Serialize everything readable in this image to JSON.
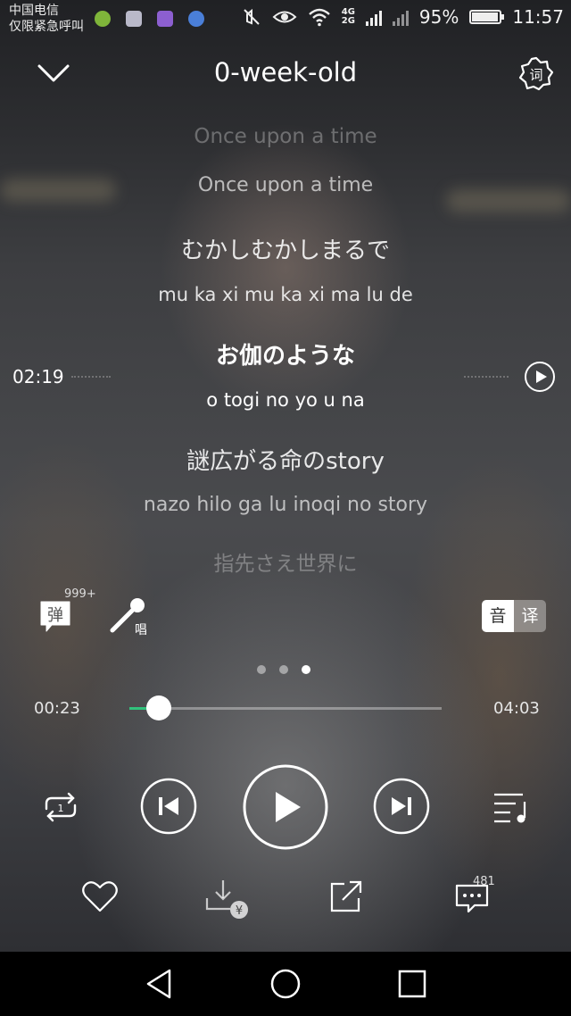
{
  "status_bar": {
    "carrier_line1": "中国电信",
    "carrier_line2": "仅限紧急呼叫",
    "network_top": "4G",
    "network_bottom": "2G",
    "battery": "95%",
    "battery_level": 0.95,
    "time": "11:57"
  },
  "header": {
    "title": "0-week-old",
    "back_icon": "chevron-down-icon",
    "settings_icon": "lyrics-settings-icon",
    "settings_glyph": "词"
  },
  "lyrics": {
    "lines": [
      {
        "text": "Once upon a time",
        "style": "faint"
      },
      {
        "text": "Once upon a time",
        "style": "dim"
      },
      {
        "text": "むかしむかしまるで",
        "style": "jp"
      },
      {
        "text": "mu ka xi mu ka xi ma lu de",
        "style": "rom"
      },
      {
        "text": "お伽のような",
        "style": "current-jp"
      },
      {
        "text": "o togi no yo u na",
        "style": "current-rom"
      },
      {
        "text": "謎広がる命のstory",
        "style": "jp"
      },
      {
        "text": "nazo hilo ga lu inoqi no story",
        "style": "dim"
      },
      {
        "text": "指先さえ世界に",
        "style": "faint"
      }
    ],
    "seek_time": "02:19"
  },
  "tools": {
    "danmu_label": "弹",
    "danmu_count": "999+",
    "sing_label": "唱",
    "toggle_on": "音",
    "toggle_off": "译"
  },
  "pager": {
    "count": 3,
    "active": 2
  },
  "progress": {
    "current": "00:23",
    "total": "04:03",
    "fraction": 0.095
  },
  "controls": {
    "loop_badge": "1",
    "download_badge": "¥",
    "comment_count": "481"
  },
  "colors": {
    "accent": "#31c27c"
  }
}
